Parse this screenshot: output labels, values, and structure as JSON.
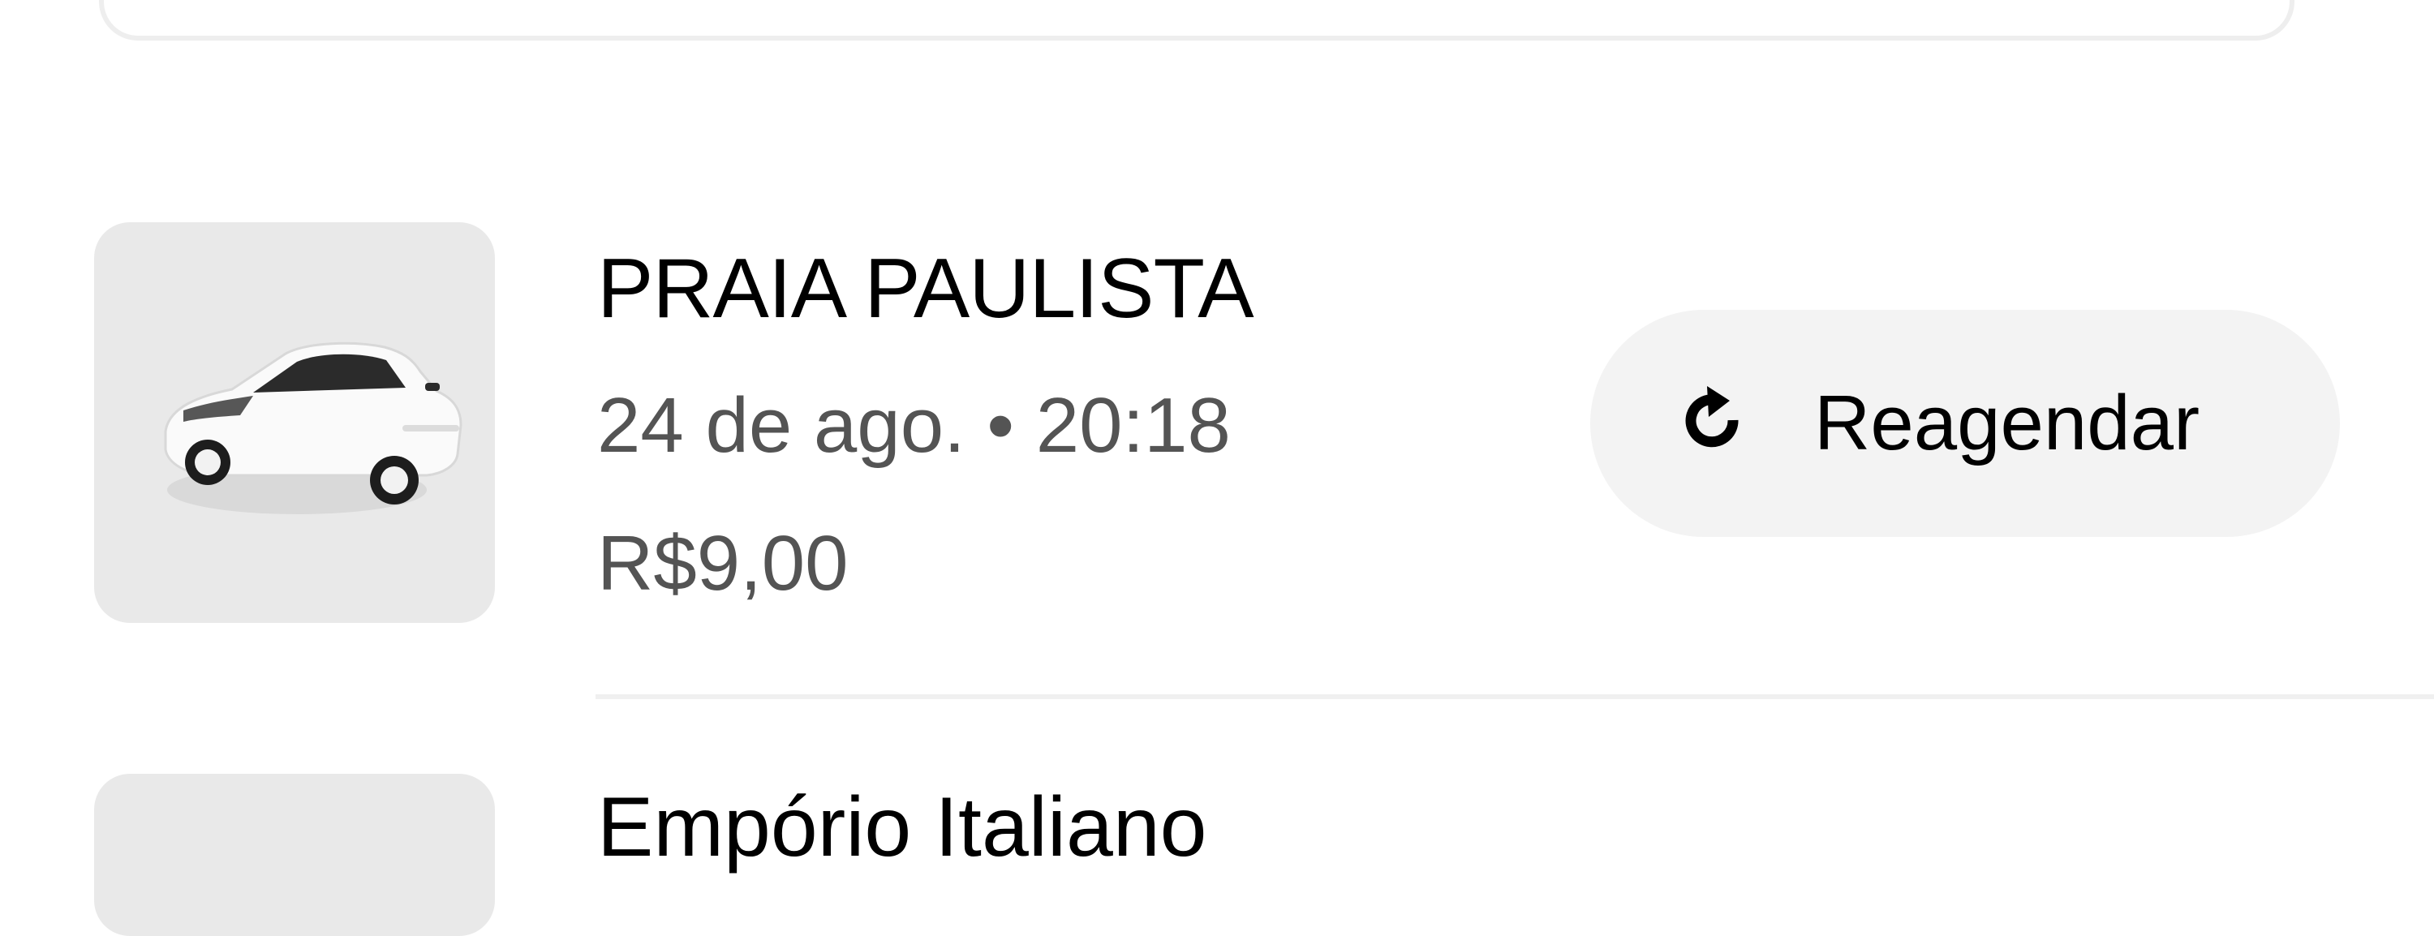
{
  "trips": [
    {
      "destination": "PRAIA PAULISTA",
      "datetime": "24 de ago. • 20:18",
      "price": "R$9,00",
      "rebook_label": "Reagendar",
      "rebook_icon": "refresh-icon",
      "vehicle_icon": "car-image"
    },
    {
      "destination": "Empório Italiano"
    }
  ],
  "colors": {
    "thumb_background": "#e9e9e9",
    "button_background": "#f3f3f3",
    "secondary_text": "#545454",
    "primary_text": "#000000"
  }
}
